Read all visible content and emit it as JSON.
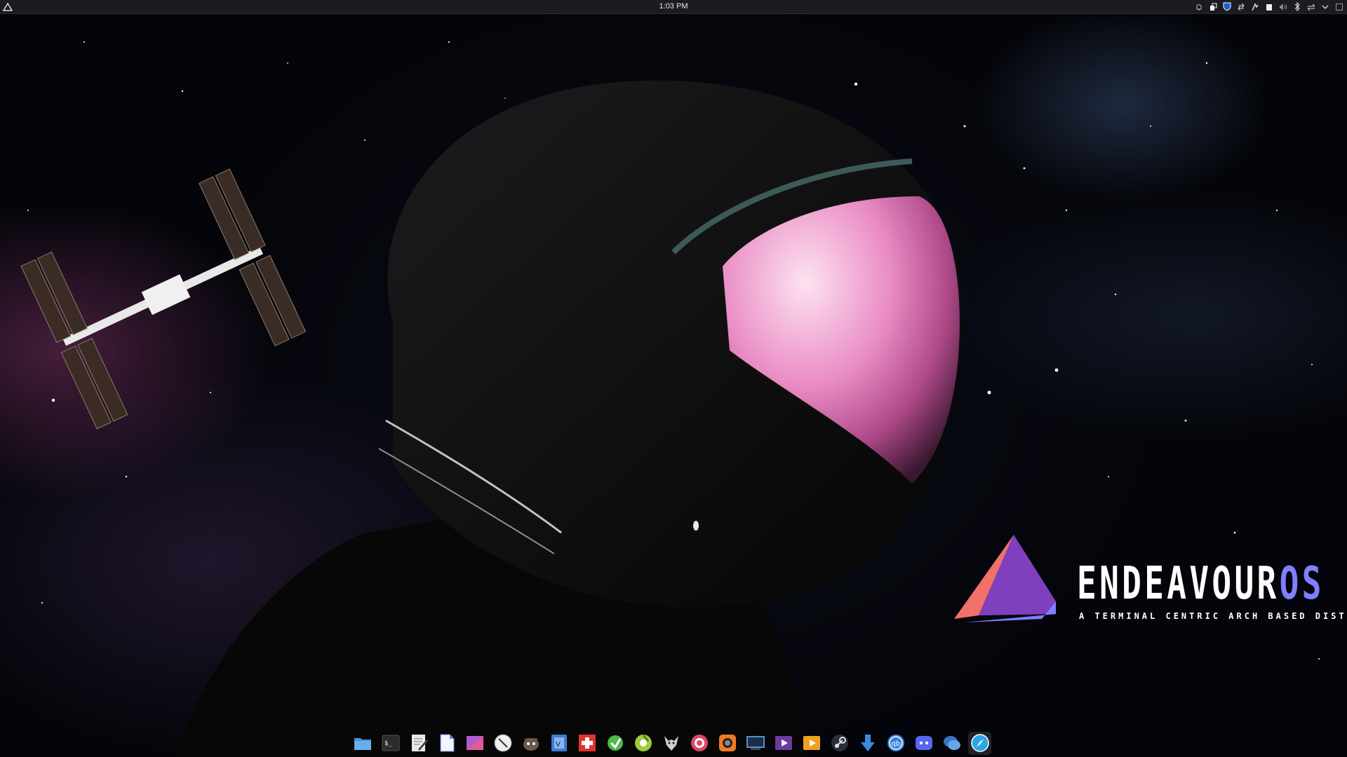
{
  "top_panel": {
    "clock": "1:03 PM",
    "launcher_icon": "endeavouros-launcher-icon",
    "tray_icons": [
      "notification-bell-icon",
      "clipboard-icon",
      "bitwarden-shield-icon",
      "network-transfer-icon",
      "kde-connect-icon",
      "device-storage-icon",
      "volume-icon",
      "bluetooth-icon",
      "network-icon",
      "expand-tray-chevron-icon",
      "show-desktop-icon"
    ]
  },
  "wallpaper": {
    "logo_text_main": "ENDEAVOUR",
    "logo_text_accent": "OS",
    "logo_tagline": "A TERMINAL CENTRIC ARCH BASED DISTRO",
    "logo_colors": {
      "triangle_left": "#f0706a",
      "triangle_main": "#7f3fbf",
      "triangle_base": "#7f7fff",
      "accent": "#7f7fff"
    }
  },
  "dock": {
    "items": [
      {
        "name": "file-manager-icon",
        "color": "#4a90d9"
      },
      {
        "name": "terminal-icon",
        "color": "#2b2b2b"
      },
      {
        "name": "text-editor-icon",
        "color": "#e8e8e8"
      },
      {
        "name": "document-viewer-icon",
        "color": "#6a7fd8"
      },
      {
        "name": "image-editor-icon",
        "color": "#b15bd1"
      },
      {
        "name": "compass-clock-icon",
        "color": "#f0f0f0"
      },
      {
        "name": "gimp-icon",
        "color": "#6b5a4e"
      },
      {
        "name": "virtualbox-icon",
        "color": "#3e7bd6"
      },
      {
        "name": "first-aid-icon",
        "color": "#e0332e"
      },
      {
        "name": "download-manager-icon",
        "color": "#4fb848"
      },
      {
        "name": "music-player-icon",
        "color": "#9ccc3c"
      },
      {
        "name": "wolf-game-icon",
        "color": "#d0d0d0"
      },
      {
        "name": "recorder-icon",
        "color": "#e04668"
      },
      {
        "name": "camera-icon",
        "color": "#ef7a25"
      },
      {
        "name": "system-monitor-icon",
        "color": "#5890c8"
      },
      {
        "name": "video-player-icon",
        "color": "#6c3aa0"
      },
      {
        "name": "media-player-icon",
        "color": "#f0a020"
      },
      {
        "name": "steam-icon",
        "color": "#2a2f3a"
      },
      {
        "name": "downloader-arrow-icon",
        "color": "#3a8ae0"
      },
      {
        "name": "qbittorrent-icon",
        "color": "#3a82d8"
      },
      {
        "name": "discord-icon",
        "color": "#5865f2"
      },
      {
        "name": "chat-bubbles-icon",
        "color": "#3a72c8"
      },
      {
        "name": "browser-compass-icon",
        "color": "#2aa7e8",
        "active": true
      }
    ]
  }
}
